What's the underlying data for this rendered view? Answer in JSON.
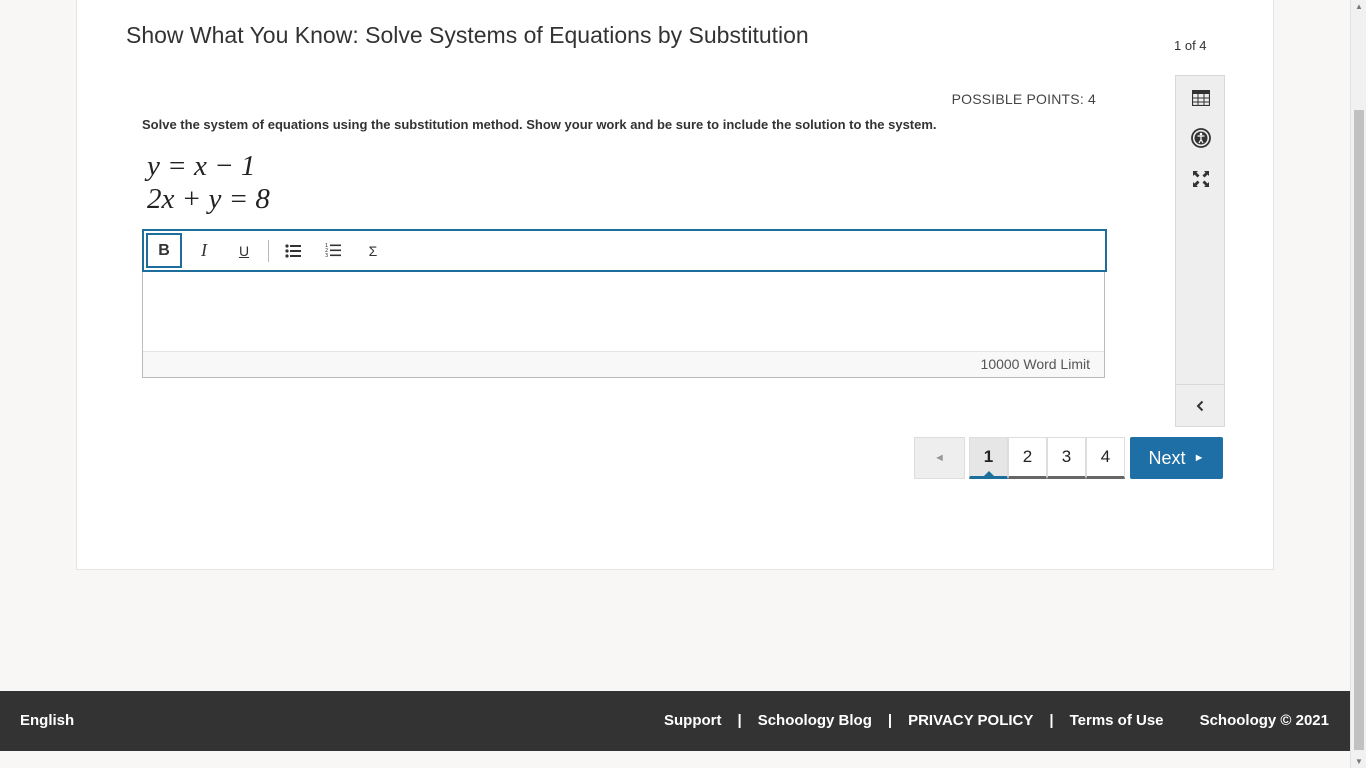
{
  "assessment": {
    "title": "Show What You Know: Solve Systems of Equations by Substitution",
    "counter": "1 of 4",
    "points": "POSSIBLE POINTS: 4",
    "prompt": "Solve the system of equations using the substitution method.  Show your work and be sure to include the solution to the system.",
    "equations": [
      "y = x − 1",
      "2x + y = 8"
    ]
  },
  "editor": {
    "toolbar": {
      "bold": "B",
      "italic": "I",
      "underline": "U",
      "bullets": "bulleted-list-icon",
      "numbered": "numbered-list-icon",
      "equation": "Σ"
    },
    "word_limit": "10000 Word Limit",
    "value": ""
  },
  "sidebar": {
    "icons": [
      "calculator-icon",
      "accessibility-icon",
      "fullscreen-icon",
      "collapse-chevron-icon"
    ]
  },
  "pager": {
    "prev": "◄",
    "pages": [
      "1",
      "2",
      "3",
      "4"
    ],
    "current": "1",
    "next": "Next",
    "next_arrow": "►"
  },
  "footer": {
    "language": "English",
    "links": [
      "Support",
      "Schoology Blog",
      "PRIVACY POLICY",
      "Terms of Use"
    ],
    "separator": "|",
    "copyright": "Schoology © 2021"
  },
  "colors": {
    "accent": "#1d6fa5",
    "footer_bg": "#333333"
  }
}
